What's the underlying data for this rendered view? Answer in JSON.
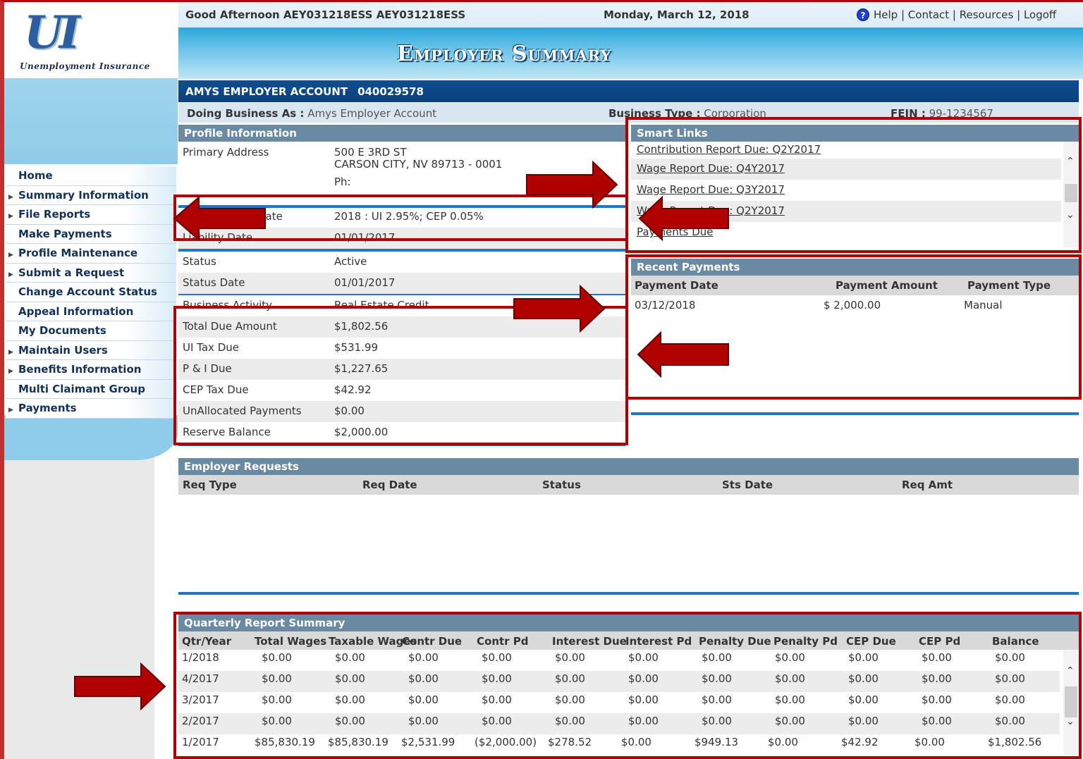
{
  "logo": {
    "letters": "UI",
    "tagline": "Unemployment Insurance"
  },
  "header": {
    "greeting": "Good Afternoon AEY031218ESS AEY031218ESS",
    "date": "Monday, March 12, 2018",
    "links": [
      "Help",
      "Contact",
      "Resources",
      "Logoff"
    ],
    "page_title": "Employer Summary"
  },
  "account": {
    "name": "AMYS EMPLOYER ACCOUNT",
    "number": "040029578",
    "dba_label": "Doing Business As :",
    "dba_value": "Amys Employer Account",
    "business_type_label": "Business Type :",
    "business_type_value": "Corporation",
    "fein_label": "FEIN :",
    "fein_value": "99-1234567"
  },
  "nav": {
    "items": [
      {
        "label": "Home",
        "arrow": false
      },
      {
        "label": "Summary Information",
        "arrow": true
      },
      {
        "label": "File Reports",
        "arrow": true
      },
      {
        "label": "Make Payments",
        "arrow": false
      },
      {
        "label": "Profile Maintenance",
        "arrow": true
      },
      {
        "label": "Submit a Request",
        "arrow": true
      },
      {
        "label": "Change Account Status",
        "arrow": false
      },
      {
        "label": "Appeal Information",
        "arrow": false
      },
      {
        "label": "My Documents",
        "arrow": false
      },
      {
        "label": "Maintain Users",
        "arrow": true
      },
      {
        "label": "Benefits Information",
        "arrow": true
      },
      {
        "label": "Multi Claimant Group",
        "arrow": false
      },
      {
        "label": "Payments",
        "arrow": true
      }
    ]
  },
  "profile": {
    "title": "Profile Information",
    "address_label": "Primary Address",
    "address_line1": "500 E 3RD ST",
    "address_line2": "CARSON CITY, NV 89713 - 0001",
    "phone_label": "Ph:",
    "rate_label": "Current Year : Rate",
    "rate_value": "2018 : UI 2.95%; CEP 0.05%",
    "liability_label": "Liability Date",
    "liability_value": "01/01/2017",
    "status_label": "Status",
    "status_value": "Active",
    "status_date_label": "Status Date",
    "status_date_value": "01/01/2017",
    "activity_label": "Business Activity",
    "activity_value": "Real Estate Credit",
    "totals": [
      {
        "label": "Total Due Amount",
        "value": "$1,802.56"
      },
      {
        "label": "UI Tax Due",
        "value": "$531.99"
      },
      {
        "label": "P & I Due",
        "value": "$1,227.65"
      },
      {
        "label": "CEP Tax Due",
        "value": "$42.92"
      },
      {
        "label": "UnAllocated Payments",
        "value": "$0.00"
      },
      {
        "label": "Reserve Balance",
        "value": "$2,000.00"
      }
    ]
  },
  "smart_links": {
    "title": "Smart Links",
    "items": [
      "Contribution Report Due: Q2Y2017",
      "Wage Report Due: Q4Y2017",
      "Wage Report Due: Q3Y2017",
      "Wage Report Due: Q2Y2017",
      "Payments Due"
    ]
  },
  "recent_payments": {
    "title": "Recent Payments",
    "headers": [
      "Payment Date",
      "Payment Amount",
      "Payment Type"
    ],
    "rows": [
      [
        "03/12/2018",
        "$ 2,000.00",
        "Manual"
      ]
    ]
  },
  "employer_requests": {
    "title": "Employer Requests",
    "headers": [
      "Req Type",
      "Req Date",
      "Status",
      "Sts Date",
      "Req Amt"
    ]
  },
  "quarterly": {
    "title": "Quarterly Report Summary",
    "headers": [
      "Qtr/Year",
      "Total Wages",
      "Taxable Wages",
      "Contr Due",
      "Contr Pd",
      "Interest Due",
      "Interest Pd",
      "Penalty Due",
      "Penalty Pd",
      "CEP Due",
      "CEP Pd",
      "Balance"
    ],
    "rows": [
      [
        "1/2018",
        "$0.00",
        "$0.00",
        "$0.00",
        "$0.00",
        "$0.00",
        "$0.00",
        "$0.00",
        "$0.00",
        "$0.00",
        "$0.00",
        "$0.00"
      ],
      [
        "4/2017",
        "$0.00",
        "$0.00",
        "$0.00",
        "$0.00",
        "$0.00",
        "$0.00",
        "$0.00",
        "$0.00",
        "$0.00",
        "$0.00",
        "$0.00"
      ],
      [
        "3/2017",
        "$0.00",
        "$0.00",
        "$0.00",
        "$0.00",
        "$0.00",
        "$0.00",
        "$0.00",
        "$0.00",
        "$0.00",
        "$0.00",
        "$0.00"
      ],
      [
        "2/2017",
        "$0.00",
        "$0.00",
        "$0.00",
        "$0.00",
        "$0.00",
        "$0.00",
        "$0.00",
        "$0.00",
        "$0.00",
        "$0.00",
        "$0.00"
      ],
      [
        "1/2017",
        "$85,830.19",
        "$85,830.19",
        "$2,531.99",
        "($2,000.00)",
        "$278.52",
        "$0.00",
        "$949.13",
        "$0.00",
        "$42.92",
        "$0.00",
        "$1,802.56"
      ]
    ]
  },
  "colors": {
    "annotation_red": "#b00000",
    "header_blue": "#0f4f94",
    "panel_header": "#6a89a3",
    "separator_blue": "#1f77c8"
  }
}
